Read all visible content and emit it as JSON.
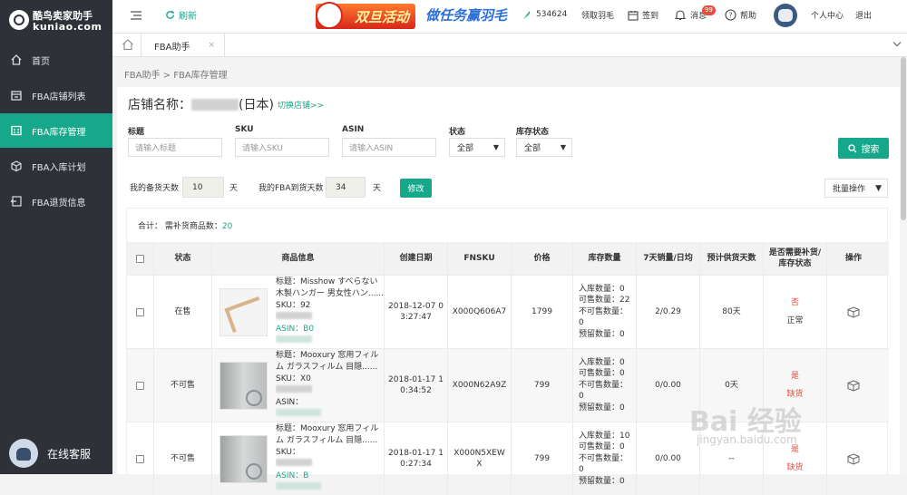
{
  "logo": {
    "line1": "酷鸟卖家助手",
    "line2": "kuniao.com"
  },
  "sidebar": {
    "items": [
      {
        "label": "首页",
        "icon": "home-icon"
      },
      {
        "label": "FBA店铺列表",
        "icon": "store-list-icon"
      },
      {
        "label": "FBA库存管理",
        "icon": "inventory-icon",
        "active": true
      },
      {
        "label": "FBA入库计划",
        "icon": "inbound-icon"
      },
      {
        "label": "FBA退货信息",
        "icon": "return-icon"
      }
    ],
    "service": "在线客服"
  },
  "topbar": {
    "refresh": "刷新",
    "promo1": "双旦活动",
    "promo2": "做任务赢羽毛",
    "feathers": "534624",
    "get_feather": "领取羽毛",
    "signin": "签到",
    "message": "消息",
    "msg_count": "99",
    "help": "帮助",
    "profile": "个人中心",
    "logout": "退出"
  },
  "tabs": {
    "current": "FBA助手",
    "close": "×"
  },
  "breadcrumb": "FBA助手 > FBA库存管理",
  "store": {
    "label": "店铺名称：",
    "region": "(日本)",
    "switch": "切换店铺>>"
  },
  "filters": {
    "title_label": "标题",
    "title_placeholder": "请输入标题",
    "sku_label": "SKU",
    "sku_placeholder": "请输入SKU",
    "asin_label": "ASIN",
    "asin_placeholder": "请输入ASIN",
    "status_label": "状态",
    "status_value": "全部",
    "stock_label": "库存状态",
    "stock_value": "全部",
    "search": "搜索"
  },
  "settings": {
    "prep_label": "我的备货天数",
    "prep_value": "10",
    "day1": "天",
    "arrive_label": "我的FBA到货天数",
    "arrive_value": "34",
    "day2": "天",
    "modify": "修改",
    "batch": "批量操作"
  },
  "summary": {
    "label": "合计： 需补货商品数：",
    "count": "20"
  },
  "table": {
    "headers": [
      "状态",
      "商品信息",
      "创建日期",
      "FNSKU",
      "价格",
      "库存数量",
      "7天销量/日均",
      "预计供货天数",
      "是否需要补货/库存状态",
      "操作"
    ],
    "rows": [
      {
        "status": "在售",
        "title": "标题：Misshow すべらない",
        "title2": "木製ハンガー 男女性ハン......",
        "sku": "SKU：92",
        "asin": "ASIN：B0",
        "date": "2018-12-07 0",
        "date2": "3:27:47",
        "fnsku": "X000Q606A7",
        "price": "1799",
        "inv": [
          "入库数量：0",
          "可售数量：22",
          "不可售数量：",
          "0",
          "预留数量：0"
        ],
        "sales": "2/0.29",
        "days": "80天",
        "need": "否",
        "state": "正常"
      },
      {
        "status": "不可售",
        "title": "标题：Mooxury 窓用フィル",
        "title2": "ム ガラスフィルム 目隠......",
        "sku": "SKU：X0",
        "asin": "ASIN：",
        "date": "2018-01-17 1",
        "date2": "0:34:52",
        "fnsku": "X000N62A9Z",
        "price": "799",
        "inv": [
          "入库数量：0",
          "可售数量：0",
          "不可售数量：",
          "0",
          "预留数量：0"
        ],
        "sales": "0/0.00",
        "days": "0天",
        "need": "是",
        "state": "缺货"
      },
      {
        "status": "不可售",
        "title": "标题：Mooxury 窓用フィル",
        "title2": "ム ガラスフィルム 目隠......",
        "sku": "SKU：",
        "asin": "ASIN：B",
        "date": "2018-01-17 1",
        "date2": "0:27:34",
        "fnsku": "X000N5XEW",
        "fnsku2": "X",
        "price": "799",
        "inv": [
          "入库数量：10",
          "可售数量：0",
          "不可售数量：",
          "0",
          "预留数量：0"
        ],
        "sales": "0/0.00",
        "days": "--",
        "need": "是",
        "state": "缺货"
      }
    ]
  },
  "watermark": {
    "brand": "Bai 经验",
    "url": "jingyan.baidu.com"
  },
  "colors": {
    "accent": "#17a88b",
    "sidebar": "#2f3138",
    "alert": "#e74c3c"
  }
}
